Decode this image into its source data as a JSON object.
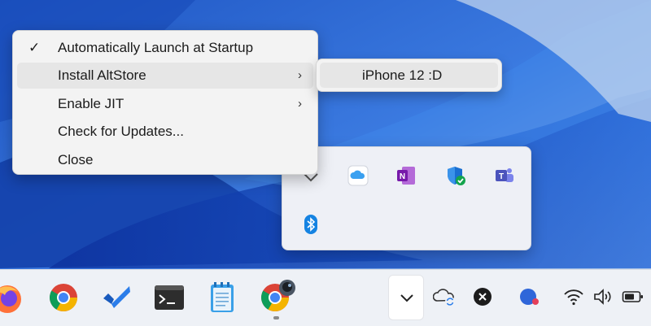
{
  "context_menu": {
    "items": [
      {
        "label": "Automatically Launch at Startup",
        "checked": true,
        "submenu": false
      },
      {
        "label": "Install AltStore",
        "checked": false,
        "submenu": true,
        "highlighted": true
      },
      {
        "label": "Enable JIT",
        "checked": false,
        "submenu": true
      },
      {
        "label": "Check for Updates...",
        "checked": false,
        "submenu": false
      },
      {
        "label": "Close",
        "checked": false,
        "submenu": false
      }
    ],
    "check_glyph": "✓",
    "arrow_glyph": "›"
  },
  "submenu": {
    "items": [
      {
        "label": "iPhone 12 :D"
      }
    ]
  },
  "tray_flyout": {
    "icons": [
      "chevron-up-icon",
      "icloud-icon",
      "onenote-icon",
      "defender-icon",
      "teams-icon",
      "bluetooth-icon"
    ]
  },
  "taskbar": {
    "apps": [
      "firefox-icon",
      "chrome-icon",
      "todo-icon",
      "terminal-icon",
      "notepad-icon",
      "chrome-profile-icon"
    ],
    "tray": [
      "show-hidden-icons-button",
      "onedrive-sync-icon",
      "close-app-icon",
      "blue-app-icon",
      "wifi-icon",
      "volume-icon",
      "battery-icon"
    ]
  },
  "colors": {
    "menu_bg": "#f3f3f3",
    "menu_highlight": "#e6e6e6",
    "taskbar_bg": "#eef1f6",
    "wallpaper_blue": "#2b67c9"
  }
}
